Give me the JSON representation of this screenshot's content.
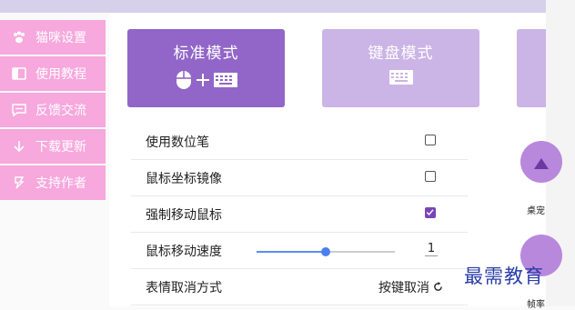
{
  "sidebar": {
    "items": [
      {
        "label": "猫咪设置",
        "icon": "paw-icon"
      },
      {
        "label": "使用教程",
        "icon": "book-icon"
      },
      {
        "label": "反馈交流",
        "icon": "chat-icon"
      },
      {
        "label": "下载更新",
        "icon": "download-icon"
      },
      {
        "label": "支持作者",
        "icon": "support-icon"
      }
    ]
  },
  "modes": [
    {
      "title": "标准模式",
      "icons": "mouse + keyboard",
      "active": true
    },
    {
      "title": "键盘模式",
      "icons": "keyboard",
      "active": false
    }
  ],
  "settings": [
    {
      "label": "使用数位笔",
      "control": "checkbox",
      "checked": false
    },
    {
      "label": "鼠标坐标镜像",
      "control": "checkbox",
      "checked": false
    },
    {
      "label": "强制移动鼠标",
      "control": "checkbox",
      "checked": true
    },
    {
      "label": "鼠标移动速度",
      "control": "slider",
      "value": "1",
      "level": 0.5
    },
    {
      "label": "表情取消方式",
      "control": "select",
      "value": "按键取消"
    }
  ],
  "right_panel": {
    "labels": [
      "桌宠",
      "帧率"
    ]
  },
  "watermark": "最需教育",
  "colors": {
    "accent": "#9166c8",
    "accent_light": "#cbb4e6",
    "sidebar_pink": "#f7a8dd",
    "check": "#7a45b8"
  }
}
